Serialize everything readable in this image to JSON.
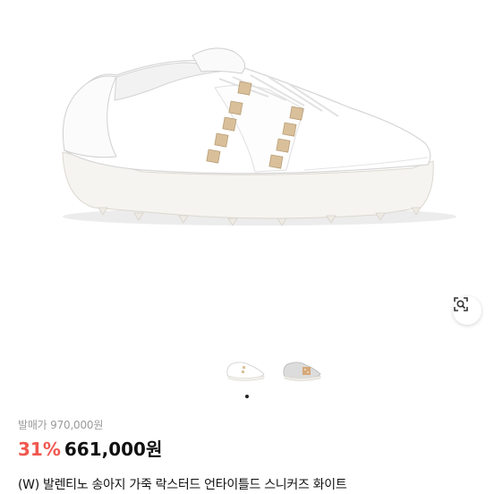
{
  "product": {
    "original_price_label": "발매가 970,000원",
    "discount_percent": "31%",
    "sale_price": "661,000원",
    "title": "(W) 발렌티노 송아지 가죽 락스터드 언타이틀드 스니커즈 화이트"
  },
  "gallery": {
    "thumbnails": [
      {
        "name": "white-sneaker-thumb"
      },
      {
        "name": "grey-sneaker-thumb"
      }
    ],
    "page_dots": 1,
    "active_dot": 0
  },
  "colors": {
    "discount": "#f0584f",
    "stud": "#d9c09a",
    "background": "#ffffff"
  },
  "icons": {
    "lens": "image-search-icon"
  }
}
